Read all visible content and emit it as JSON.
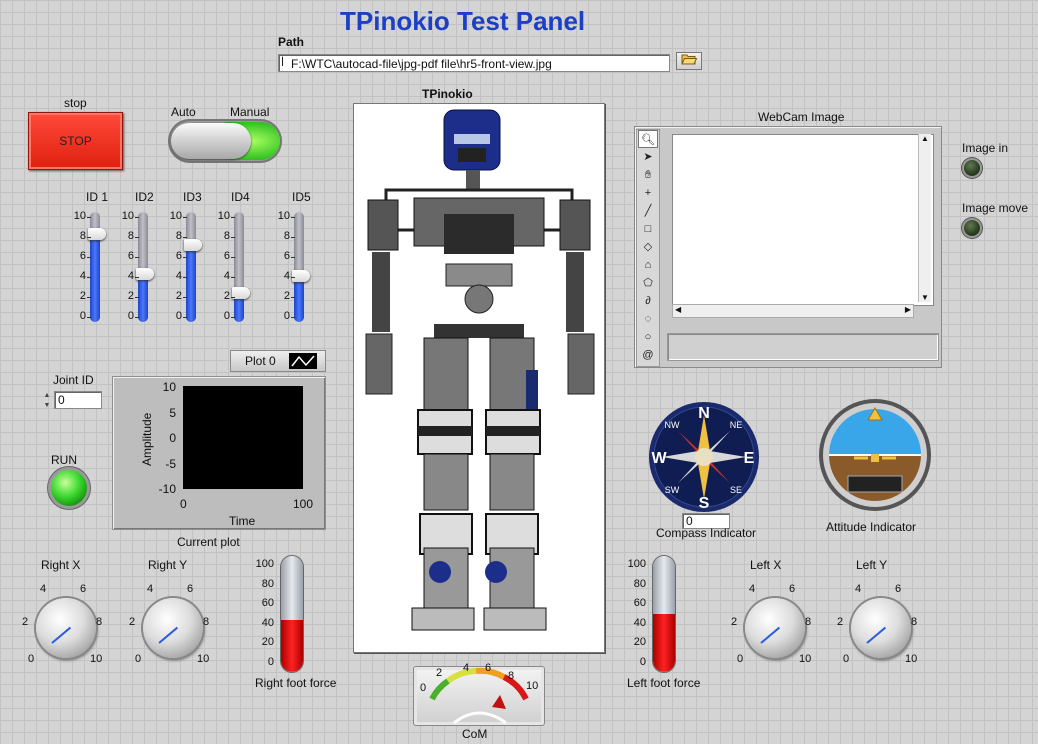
{
  "title": "TPinokio Test Panel",
  "path": {
    "label": "Path",
    "prefix": "ꟾ",
    "value": "F:\\WTC\\autocad-file\\jpg-pdf file\\hr5-front-view.jpg",
    "browse_icon": "folder-open-icon"
  },
  "stop": {
    "label": "stop",
    "button": "STOP",
    "color": "#ff3322"
  },
  "mode": {
    "left": "Auto",
    "right": "Manual",
    "state": "Manual"
  },
  "sliders": [
    {
      "label": "ID 1",
      "value": 8
    },
    {
      "label": "ID2",
      "value": 4.4
    },
    {
      "label": "ID3",
      "value": 7
    },
    {
      "label": "ID4",
      "value": 2.6
    },
    {
      "label": "ID5",
      "value": 4.2
    }
  ],
  "slider_ticks": [
    "10",
    "8",
    "6",
    "4",
    "2",
    "0"
  ],
  "plot": {
    "legend": "Plot 0",
    "caption": "Current plot",
    "xlabel": "Time",
    "ylabel": "Amplitude",
    "yticks": [
      "10",
      "5",
      "0",
      "-5",
      "-10"
    ],
    "xticks": [
      "0",
      "100"
    ]
  },
  "joint": {
    "label": "Joint ID",
    "value": "0"
  },
  "run": {
    "label": "RUN",
    "color": "#39d82c"
  },
  "robot": {
    "label": "TPinokio"
  },
  "webcam": {
    "label": "WebCam Image"
  },
  "leds": {
    "image_in": "Image in",
    "image_move": "Image move"
  },
  "compass": {
    "caption": "Compass Indicator",
    "value": "0",
    "n": "N",
    "s": "S",
    "e": "E",
    "w": "W",
    "nw": "NW",
    "ne": "NE",
    "sw": "SW",
    "se": "SE"
  },
  "attitude": {
    "caption": "Attitude Indicator"
  },
  "force": {
    "right_label": "Right foot force",
    "left_label": "Left foot force",
    "ticks": [
      "100",
      "80",
      "60",
      "40",
      "20",
      "0"
    ],
    "right_value": 45,
    "left_value": 50
  },
  "knobs": [
    {
      "label": "Right X"
    },
    {
      "label": "Right Y"
    },
    {
      "label": "Left X"
    },
    {
      "label": "Left Y"
    }
  ],
  "knob_ticks": {
    "t0": "0",
    "t2": "2",
    "t4": "4",
    "t6": "6",
    "t8": "8",
    "t10": "10"
  },
  "com": {
    "label": "CoM",
    "ticks": [
      "0",
      "2",
      "4",
      "6",
      "8",
      "10"
    ],
    "value": 6.8
  }
}
